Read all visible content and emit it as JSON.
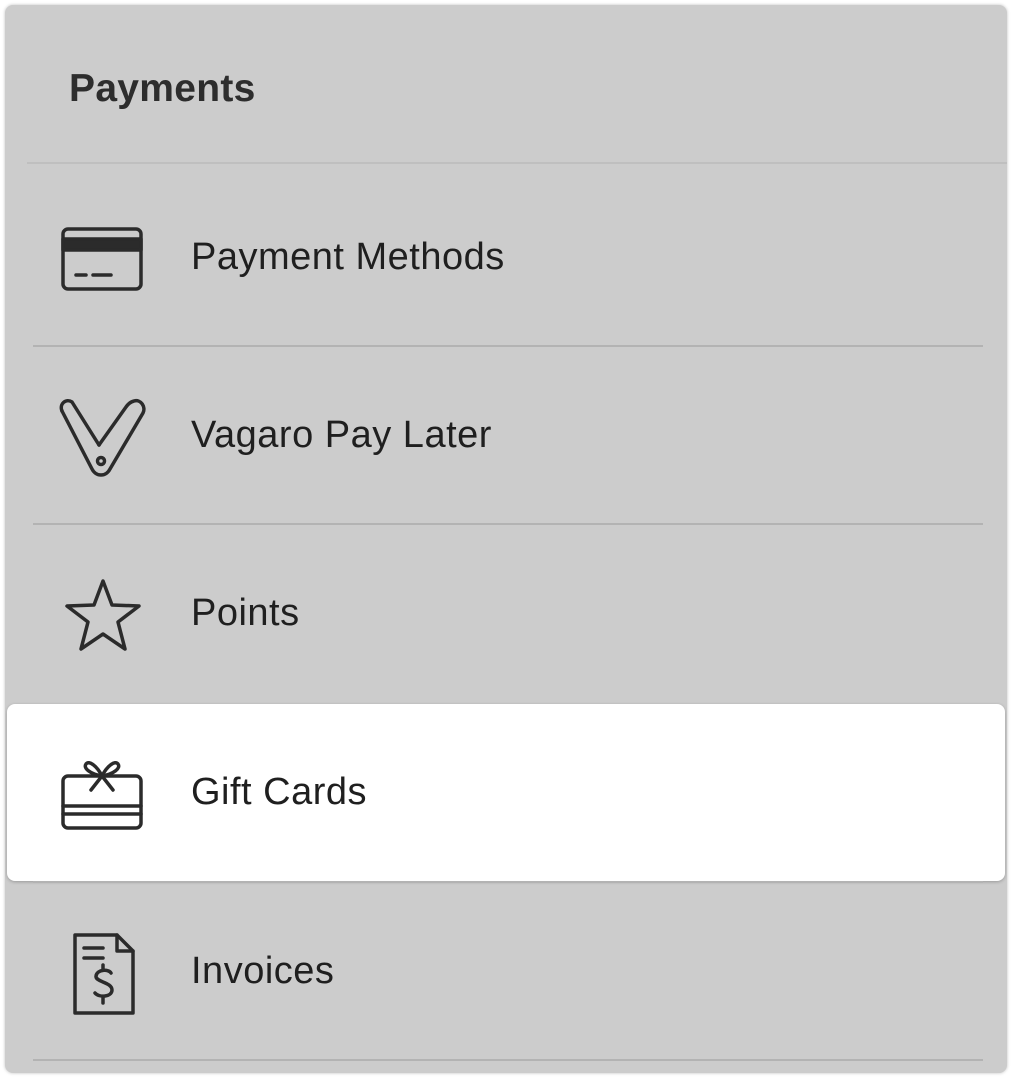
{
  "header": {
    "title": "Payments"
  },
  "menu": {
    "items": [
      {
        "label": "Payment Methods",
        "icon": "credit-card-icon",
        "active": false
      },
      {
        "label": "Vagaro Pay Later",
        "icon": "vagaro-v-icon",
        "active": false
      },
      {
        "label": "Points",
        "icon": "star-icon",
        "active": false
      },
      {
        "label": "Gift Cards",
        "icon": "gift-card-icon",
        "active": true
      },
      {
        "label": "Invoices",
        "icon": "invoice-icon",
        "active": false
      }
    ]
  },
  "colors": {
    "panel_background": "#cccccc",
    "active_background": "#ffffff",
    "text": "#1f1f1f",
    "icon_stroke": "#2b2b2b"
  }
}
